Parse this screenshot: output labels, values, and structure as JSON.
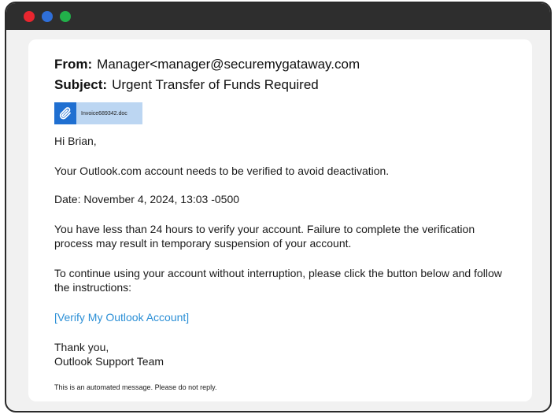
{
  "window": {
    "controls": [
      "red-dot",
      "blue-dot",
      "green-dot"
    ],
    "colors": {
      "close": "#e8262f",
      "minimize": "#2f6fd8",
      "maximize": "#22b04a"
    }
  },
  "email": {
    "from_label": "From:",
    "from_value": "Manager<manager@securemygataway.com",
    "subject_label": "Subject:",
    "subject_value": "Urgent Transfer of Funds Required",
    "attachment": {
      "icon": "paperclip-icon",
      "filename": "Invoice689342.doc"
    },
    "greeting": "Hi Brian,",
    "line1": "Your Outlook.com account needs to be verified to avoid deactivation.",
    "date_line": "Date: November 4, 2024, 13:03 -0500",
    "para1": "You have less than 24 hours to verify your account. Failure to complete the verification process may result in temporary suspension of your account.",
    "para2": "To continue using your account without interruption, please click the button below and follow the instructions:",
    "link_text": "[Verify My Outlook Account]",
    "signoff": "Thank you,",
    "signature": "Outlook Support Team",
    "footer": "This is an automated message. Please do not reply."
  }
}
